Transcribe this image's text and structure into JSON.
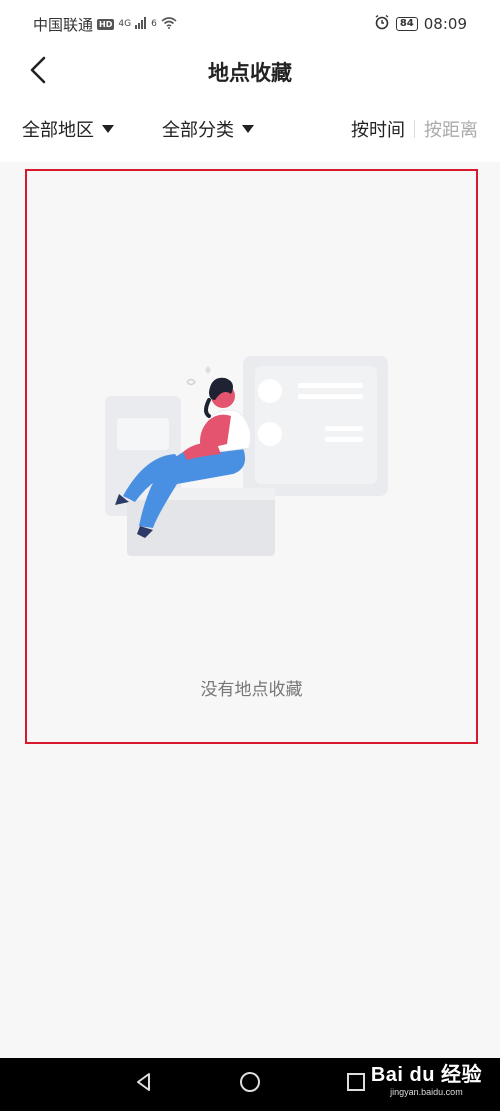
{
  "status_bar": {
    "carrier": "中国联通",
    "hd_badge": "HD",
    "network": "4G",
    "signal_extra": "6",
    "battery": "84",
    "time": "08:09",
    "icons": [
      "signal-icon",
      "wifi-icon",
      "alarm-icon",
      "battery-icon"
    ]
  },
  "header": {
    "title": "地点收藏",
    "back_icon": "chevron-left-icon"
  },
  "filters": {
    "region_label": "全部地区",
    "category_label": "全部分类",
    "sort_time_label": "按时间",
    "sort_distance_label": "按距离"
  },
  "empty_state": {
    "message": "没有地点收藏",
    "illustration": "person-sitting-illustration"
  },
  "nav_bar": {
    "back_icon": "triangle-back-icon",
    "home_icon": "circle-home-icon",
    "recent_icon": "square-recent-icon"
  },
  "watermark": {
    "brand": "Bai du 经验",
    "url": "jingyan.baidu.com"
  },
  "colors": {
    "highlight_border": "#d8182d",
    "background": "#f7f7f7",
    "accent_person": "#e4546f",
    "pants": "#4a90e2"
  }
}
